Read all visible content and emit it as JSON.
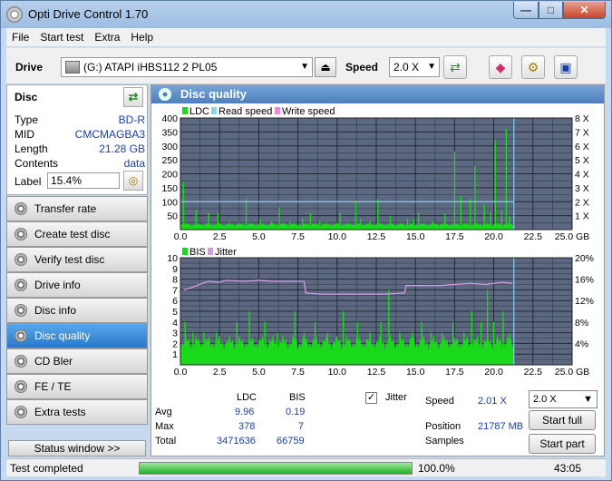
{
  "window": {
    "title": "Opti Drive Control 1.70"
  },
  "menu": [
    "File",
    "Start test",
    "Extra",
    "Help"
  ],
  "toolbar": {
    "drive_label": "Drive",
    "drive_value": "(G:)   ATAPI iHBS112   2 PL05",
    "speed_label": "Speed",
    "speed_value": "2.0 X"
  },
  "disc": {
    "title": "Disc",
    "rows": [
      {
        "key": "Type",
        "value": "BD-R"
      },
      {
        "key": "MID",
        "value": "CMCMAGBA3"
      },
      {
        "key": "Length",
        "value": "21.28 GB"
      },
      {
        "key": "Contents",
        "value": "data"
      }
    ],
    "label_key": "Label",
    "label_value": "15.4%"
  },
  "nav": [
    "Transfer rate",
    "Create test disc",
    "Verify test disc",
    "Drive info",
    "Disc info",
    "Disc quality",
    "CD Bler",
    "FE / TE",
    "Extra tests"
  ],
  "nav_active": 5,
  "status_window_label": "Status window >>",
  "panel_title": "Disc quality",
  "chart_data": [
    {
      "type": "bar",
      "legend": [
        "LDC",
        "Read speed",
        "Write speed"
      ],
      "x_ticks": [
        "0.0",
        "2.5",
        "5.0",
        "7.5",
        "10.0",
        "12.5",
        "15.0",
        "17.5",
        "20.0",
        "22.5",
        "25.0 GB"
      ],
      "y_ticks": [
        "400",
        "350",
        "300",
        "250",
        "200",
        "150",
        "100",
        "50"
      ],
      "y2_ticks": [
        "8 X",
        "7 X",
        "6 X",
        "5 X",
        "4 X",
        "3 X",
        "2 X",
        "1 X"
      ],
      "xlim": [
        0,
        25
      ],
      "ylim": [
        0,
        400
      ],
      "y2lim": [
        0,
        8
      ],
      "ldc_base": 20,
      "spikes": [
        [
          0.2,
          170
        ],
        [
          1.0,
          70
        ],
        [
          1.8,
          60
        ],
        [
          2.4,
          60
        ],
        [
          4.2,
          110
        ],
        [
          5.1,
          40
        ],
        [
          5.8,
          30
        ],
        [
          6.3,
          80
        ],
        [
          7.0,
          30
        ],
        [
          7.8,
          40
        ],
        [
          8.3,
          60
        ],
        [
          8.9,
          30
        ],
        [
          10.2,
          60
        ],
        [
          11.2,
          100
        ],
        [
          11.5,
          40
        ],
        [
          12.1,
          30
        ],
        [
          12.6,
          110
        ],
        [
          13.4,
          50
        ],
        [
          14.5,
          40
        ],
        [
          14.9,
          40
        ],
        [
          15.2,
          60
        ],
        [
          16.1,
          30
        ],
        [
          16.9,
          60
        ],
        [
          17.5,
          280
        ],
        [
          17.9,
          120
        ],
        [
          18.5,
          110
        ],
        [
          18.8,
          230
        ],
        [
          19.4,
          90
        ],
        [
          19.8,
          60
        ],
        [
          20.1,
          320
        ],
        [
          20.5,
          70
        ],
        [
          20.8,
          360
        ],
        [
          21.0,
          50
        ]
      ],
      "read_speed_x": [
        0,
        21.28
      ],
      "read_speed_y": 2.0,
      "disc_end": 21.28
    },
    {
      "type": "bar",
      "legend": [
        "BIS",
        "Jitter"
      ],
      "x_ticks": [
        "0.0",
        "2.5",
        "5.0",
        "7.5",
        "10.0",
        "12.5",
        "15.0",
        "17.5",
        "20.0",
        "22.5",
        "25.0 GB"
      ],
      "y_ticks": [
        "10",
        "9",
        "8",
        "7",
        "6",
        "5",
        "4",
        "3",
        "2",
        "1"
      ],
      "y2_ticks": [
        "20%",
        "16%",
        "12%",
        "8%",
        "4%"
      ],
      "xlim": [
        0,
        25
      ],
      "ylim": [
        0,
        10
      ],
      "y2lim": [
        0,
        20
      ],
      "bis_base": 2.2,
      "bis_spikes": [
        [
          0.3,
          4
        ],
        [
          0.8,
          3
        ],
        [
          1.5,
          3
        ],
        [
          2.3,
          3
        ],
        [
          3.6,
          4
        ],
        [
          4.4,
          5
        ],
        [
          5.4,
          4
        ],
        [
          6.2,
          3
        ],
        [
          7.3,
          5
        ],
        [
          7.9,
          3
        ],
        [
          8.6,
          4
        ],
        [
          9.4,
          3
        ],
        [
          10.4,
          5
        ],
        [
          11.3,
          4
        ],
        [
          12.1,
          3
        ],
        [
          12.8,
          4
        ],
        [
          13.3,
          7
        ],
        [
          14.0,
          3
        ],
        [
          14.8,
          3
        ],
        [
          15.4,
          4
        ],
        [
          16.0,
          3
        ],
        [
          16.7,
          3
        ],
        [
          17.4,
          4
        ],
        [
          18.1,
          3
        ],
        [
          18.6,
          5
        ],
        [
          19.2,
          4
        ],
        [
          19.6,
          7
        ],
        [
          20.0,
          4
        ],
        [
          20.6,
          5
        ],
        [
          21.0,
          3
        ]
      ],
      "jitter": [
        [
          0.2,
          14.0
        ],
        [
          0.7,
          14.4
        ],
        [
          1.2,
          15.0
        ],
        [
          1.8,
          15.6
        ],
        [
          2.4,
          15.4
        ],
        [
          3.0,
          15.8
        ],
        [
          4.0,
          15.6
        ],
        [
          5.0,
          15.8
        ],
        [
          6.0,
          15.6
        ],
        [
          7.0,
          15.6
        ],
        [
          7.9,
          15.6
        ],
        [
          8.0,
          13.4
        ],
        [
          9.0,
          13.2
        ],
        [
          10.0,
          13.2
        ],
        [
          11.0,
          13.2
        ],
        [
          12.0,
          13.2
        ],
        [
          13.0,
          13.2
        ],
        [
          14.3,
          13.4
        ],
        [
          14.4,
          14.8
        ],
        [
          15.5,
          14.8
        ],
        [
          16.5,
          14.8
        ],
        [
          17.5,
          15.0
        ],
        [
          18.5,
          15.2
        ],
        [
          19.5,
          15.0
        ],
        [
          20.5,
          15.4
        ],
        [
          21.2,
          15.2
        ]
      ],
      "disc_end": 21.28
    }
  ],
  "stats": {
    "col_ldc": "LDC",
    "col_bis": "BIS",
    "rows": [
      {
        "label": "Avg",
        "ldc": "9.96",
        "bis": "0.19"
      },
      {
        "label": "Max",
        "ldc": "378",
        "bis": "7"
      },
      {
        "label": "Total",
        "ldc": "3471636",
        "bis": "66759"
      }
    ],
    "jitter_label": "Jitter",
    "jitter_checked": true,
    "speed_label": "Speed",
    "speed_value": "2.01 X",
    "position_label": "Position",
    "position_value": "21787 MB",
    "samples_label": "Samples",
    "speed_dd": "2.0 X",
    "start_full": "Start full",
    "start_part": "Start part"
  },
  "status": {
    "text": "Test completed",
    "progress": 100.0,
    "progress_text": "100.0%",
    "time": "43:05"
  },
  "colors": {
    "plot_bg": "#5c6780",
    "grid": "#24283a",
    "ldc": "#1ad81a",
    "read_speed": "#8fd3f2",
    "write_speed": "#ff7fe8",
    "jitter": "#d39ae0"
  }
}
